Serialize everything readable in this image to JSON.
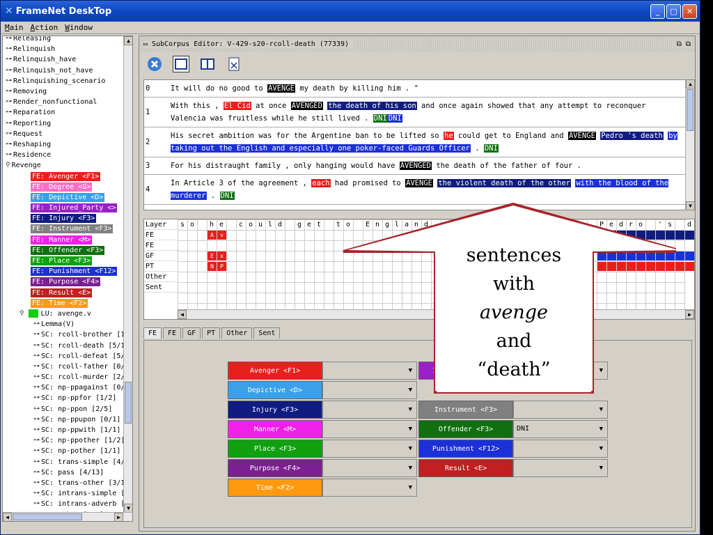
{
  "window": {
    "title": "FrameNet DeskTop"
  },
  "menu": [
    "Main",
    "Action",
    "Window"
  ],
  "tree": {
    "frames": [
      "Releasing",
      "Relinquish",
      "Relinquish_have",
      "Relinquish_not_have",
      "Relinquishing_scenario",
      "Removing",
      "Render_nonfunctional",
      "Reparation",
      "Reporting",
      "Request",
      "Reshaping",
      "Residence",
      "Revenge"
    ],
    "fes": [
      {
        "label": "FE: Avenger <F1>",
        "color": "#e8201c"
      },
      {
        "label": "FE: Degree <G>",
        "color": "#ff6ec7"
      },
      {
        "label": "FE: Depictive <D>",
        "color": "#3aa0e8"
      },
      {
        "label": "FE: Injured_Party <>",
        "color": "#9a20c8"
      },
      {
        "label": "FE: Injury <F3>",
        "color": "#101c80"
      },
      {
        "label": "FE: Instrument <F3>",
        "color": "#808080"
      },
      {
        "label": "FE: Manner <M>",
        "color": "#f020e8"
      },
      {
        "label": "FE: Offender <F3>",
        "color": "#107010"
      },
      {
        "label": "FE: Place <F3>",
        "color": "#10a010"
      },
      {
        "label": "FE: Punishment <F12>",
        "color": "#1c30d8"
      },
      {
        "label": "FE: Purpose <F4>",
        "color": "#7a2090"
      },
      {
        "label": "FE: Result <E>",
        "color": "#c02020"
      },
      {
        "label": "FE: Time <F2>",
        "color": "#ff9a10"
      }
    ],
    "lu": "LU: avenge.v",
    "lemma": "Lemma(V)",
    "scs": [
      "SC: rcoll-brother [1/",
      "SC: rcoll-death [5/1",
      "SC: rcoll-defeat [5/",
      "SC: rcoll-father [0/",
      "SC: rcoll-murder [2/",
      "SC: np-ppagainst [0/",
      "SC: np-ppfor [1/2]",
      "SC: np-ppon [2/5]",
      "SC: np-ppupon [0/1]",
      "SC: np-ppwith [1/1]",
      "SC: np-ppother [1/2]",
      "SC: np-pother [1/1]",
      "SC: trans-simple [4/",
      "SC: pass [4/13]",
      "SC: trans-other [3/1",
      "SC: intrans-simple [",
      "SC: intrans-adverb [",
      "SC: other [1/5]"
    ]
  },
  "editor": {
    "title": "SubCorpus Editor: V-429-s20-rcoll-death (77339)",
    "sentences": [
      {
        "num": "0",
        "parts": [
          [
            "It will do no good to ",
            ""
          ],
          [
            "AVENGE",
            "#000"
          ],
          [
            " my death by killing him . \"",
            ""
          ]
        ]
      },
      {
        "num": "1",
        "parts": [
          [
            "With this , ",
            ""
          ],
          [
            "El Cid",
            "#e8201c"
          ],
          [
            " at once ",
            ""
          ],
          [
            "AVENGED",
            "#000"
          ],
          [
            " ",
            ""
          ],
          [
            "the death of his son",
            "#101c80"
          ],
          [
            " and once again showed that any attempt to reconquer Valencia was fruitless while he still lived . ",
            ""
          ],
          [
            "DNI",
            "#107010"
          ],
          [
            "DNI",
            "#1c30d8"
          ]
        ]
      },
      {
        "num": "2",
        "parts": [
          [
            "His secret ambition was for the Argentine ban to be lifted so ",
            ""
          ],
          [
            "he",
            "#e8201c"
          ],
          [
            " could get to England and ",
            ""
          ],
          [
            "AVENGE",
            "#000"
          ],
          [
            " ",
            ""
          ],
          [
            "Pedro 's death",
            "#101c80"
          ],
          [
            " ",
            ""
          ],
          [
            "by taking out the English and especially one poker-faced Guards Officer",
            "#1c30d8"
          ],
          [
            " . ",
            ""
          ],
          [
            "DNI",
            "#107010"
          ]
        ]
      },
      {
        "num": "3",
        "parts": [
          [
            "For his distraught family , only hanging would have ",
            ""
          ],
          [
            "AVENGED",
            "#000"
          ],
          [
            " the death of the father of four .",
            ""
          ]
        ]
      },
      {
        "num": "4",
        "parts": [
          [
            "In Article 3 of the agreement , ",
            ""
          ],
          [
            "each",
            "#e8201c"
          ],
          [
            " had promised to ",
            ""
          ],
          [
            "AVENGE",
            "#000"
          ],
          [
            " ",
            ""
          ],
          [
            "the violent death of the other",
            "#101c80"
          ],
          [
            " ",
            ""
          ],
          [
            "with the blood of the murderer",
            "#1c30d8"
          ],
          [
            " . ",
            ""
          ],
          [
            "DNI",
            "#107010"
          ]
        ]
      }
    ],
    "layers": [
      "Layer",
      "FE",
      "FE",
      "GF",
      "PT",
      "Other",
      "Sent"
    ],
    "letters": [
      "s",
      "o",
      "",
      "h",
      "e",
      "",
      "c",
      "o",
      "u",
      "l",
      "d",
      "",
      "g",
      "e",
      "t",
      "",
      "t",
      "o",
      "",
      "E",
      "n",
      "g",
      "l",
      "a",
      "n",
      "d",
      "",
      "a",
      "n",
      "d",
      "",
      "",
      "",
      "",
      "",
      "",
      "",
      "",
      "",
      "",
      "",
      "",
      "",
      "P",
      "e",
      "d",
      "r",
      "o",
      "",
      "'",
      "s",
      "",
      "d",
      "e",
      "a",
      "t",
      "h"
    ],
    "tabs": [
      "FE",
      "FE",
      "GF",
      "PT",
      "Other",
      "Sent"
    ],
    "fe_buttons": [
      {
        "label": "Avenger <F1>",
        "color": "#e8201c",
        "value": ""
      },
      {
        "label": "Injured_Party <>",
        "color": "#9a20c8",
        "value": ""
      },
      {
        "label": "Depictive <D>",
        "color": "#3aa0e8",
        "value": ""
      },
      {
        "label": "Injury <F3>",
        "color": "#101c80",
        "value": ""
      },
      {
        "label": "Instrument <F3>",
        "color": "#808080",
        "value": ""
      },
      {
        "label": "Manner <M>",
        "color": "#f020e8",
        "value": ""
      },
      {
        "label": "Offender <F3>",
        "color": "#107010",
        "value": "DNI"
      },
      {
        "label": "Place <F3>",
        "color": "#10a010",
        "value": ""
      },
      {
        "label": "Punishment <F12>",
        "color": "#1c30d8",
        "value": ""
      },
      {
        "label": "Purpose <F4>",
        "color": "#7a2090",
        "value": ""
      },
      {
        "label": "Result <E>",
        "color": "#c02020",
        "value": ""
      },
      {
        "label": "Time <F2>",
        "color": "#ff9a10",
        "value": ""
      }
    ]
  },
  "callout": {
    "line1": "sentences",
    "line2": "with",
    "line3": "avenge",
    "line4": "and",
    "line5": "“death”"
  }
}
